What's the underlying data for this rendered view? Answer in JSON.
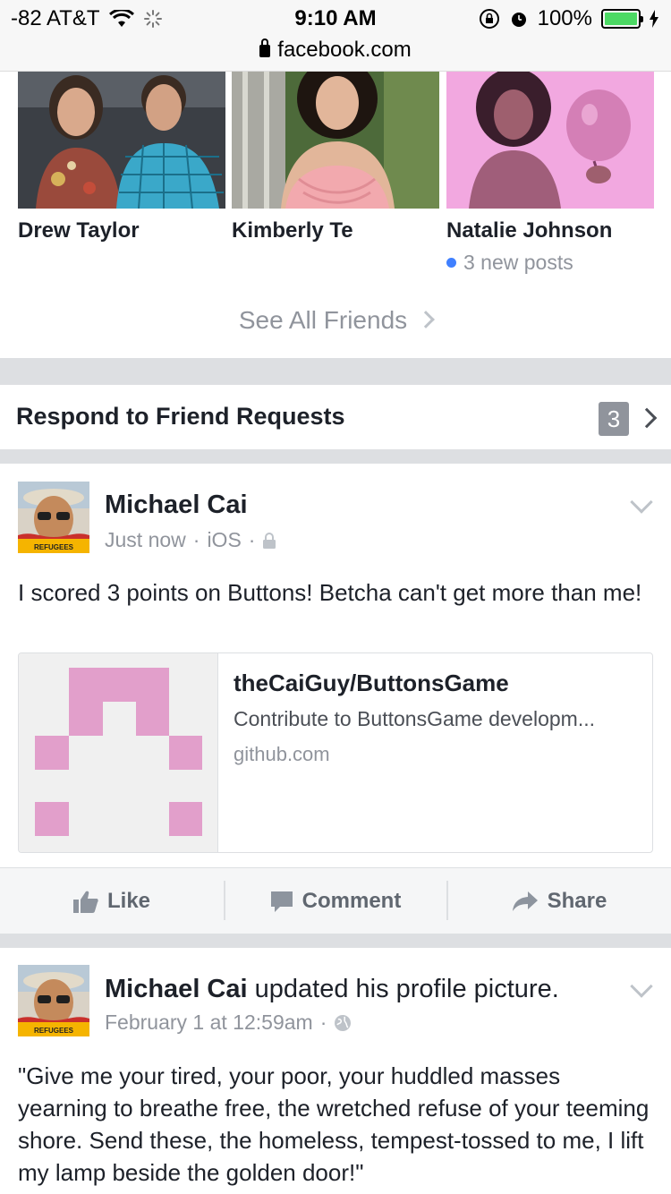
{
  "status_bar": {
    "carrier": "-82 AT&T",
    "time": "9:10 AM",
    "battery": "100%",
    "url": "facebook.com"
  },
  "friends": [
    {
      "name": "Drew Taylor"
    },
    {
      "name": "Kimberly Te"
    },
    {
      "name": "Natalie Johnson",
      "new_posts": "3 new posts"
    }
  ],
  "see_all": "See All Friends",
  "friend_requests": {
    "title": "Respond to Friend Requests",
    "count": "3"
  },
  "posts": [
    {
      "author": "Michael Cai",
      "action": "",
      "time": "Just now",
      "source": "iOS",
      "text": "I scored 3 points on Buttons! Betcha can't get more than me!",
      "link": {
        "title": "theCaiGuy/ButtonsGame",
        "description": "Contribute to ButtonsGame developm...",
        "domain": "github.com"
      },
      "actions": {
        "like": "Like",
        "comment": "Comment",
        "share": "Share"
      }
    },
    {
      "author": "Michael Cai",
      "action": "updated his profile picture.",
      "time": "February 1 at 12:59am",
      "text": "\"Give me your tired, your poor, your huddled masses yearning to breathe free, the wretched refuse of your teeming shore. Send these, the homeless, tempest-tossed to me, I lift my lamp beside the golden door!\""
    }
  ],
  "avatar_badge": "REFUGEES",
  "colors": {
    "link_blue": "#4080ff",
    "muted": "#90949c",
    "pink": "#e29fcb"
  }
}
